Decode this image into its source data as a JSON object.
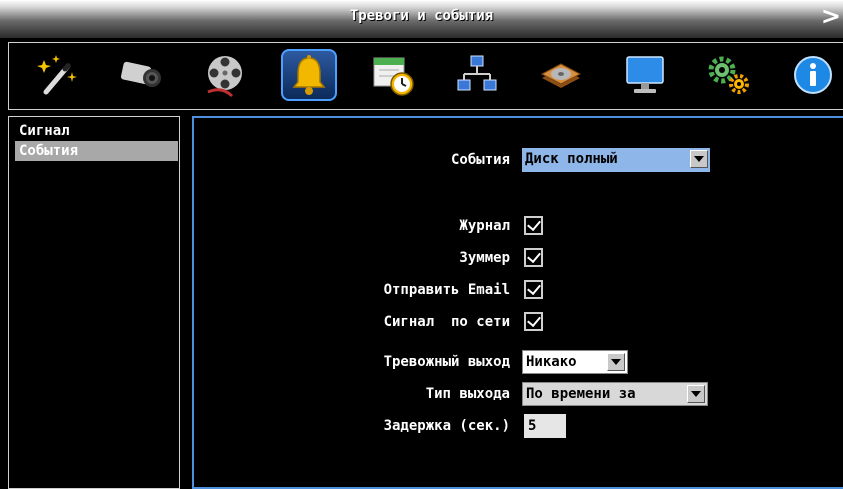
{
  "window": {
    "title": "Тревоги и события"
  },
  "toolbar": {
    "icons": [
      "magic-wand-icon",
      "camera-icon",
      "film-reel-icon",
      "bell-icon",
      "schedule-clock-icon",
      "network-icon",
      "hard-disk-icon",
      "monitor-icon",
      "gears-icon",
      "info-icon"
    ],
    "active_index": 3
  },
  "sidebar": {
    "items": [
      {
        "label": "Сигнал",
        "selected": false
      },
      {
        "label": "События",
        "selected": true
      }
    ]
  },
  "form": {
    "event": {
      "label": "События",
      "value": "Диск полный"
    },
    "journal": {
      "label": "Журнал",
      "checked": true
    },
    "buzzer": {
      "label": "Зуммер",
      "checked": true
    },
    "send_email": {
      "label": "Отправить Email",
      "checked": true
    },
    "network_signal": {
      "label": "Сигнал  по сети",
      "checked": true
    },
    "alarm_out": {
      "label": "Тревожный выход",
      "value": "Никако"
    },
    "out_type": {
      "label": "Тип выхода",
      "value": "По времени за"
    },
    "delay": {
      "label": "Задержка (сек.)",
      "value": "5"
    }
  },
  "colors": {
    "accent": "#4f8fe0",
    "selected_bg": "#a8a8a8",
    "dropdown_bg": "#8fb6e8"
  }
}
